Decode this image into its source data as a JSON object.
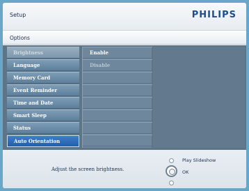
{
  "header": {
    "title": "Setup",
    "brand": "PHILIPS"
  },
  "breadcrumb": {
    "label": "Options"
  },
  "menu": {
    "items": [
      {
        "label": "Brightness",
        "state": "dim"
      },
      {
        "label": "Language",
        "state": "normal"
      },
      {
        "label": "Memory Card",
        "state": "normal"
      },
      {
        "label": "Event Reminder",
        "state": "normal"
      },
      {
        "label": "Time and Date",
        "state": "normal"
      },
      {
        "label": "Smart Sleep",
        "state": "normal"
      },
      {
        "label": "Status",
        "state": "normal"
      },
      {
        "label": "Auto Orientation",
        "state": "selected"
      }
    ]
  },
  "submenu": {
    "items": [
      {
        "label": "Enable",
        "state": "normal"
      },
      {
        "label": "Disable",
        "state": "dim"
      }
    ]
  },
  "footer": {
    "hint": "Adjust the screen brightness.",
    "play_label": "Play Slideshow",
    "ok_label": "OK"
  },
  "colors": {
    "brand": "#1c4d93",
    "selected": "#2f6fbe",
    "panel": "#5e7487",
    "background": "#6aa6c8"
  }
}
